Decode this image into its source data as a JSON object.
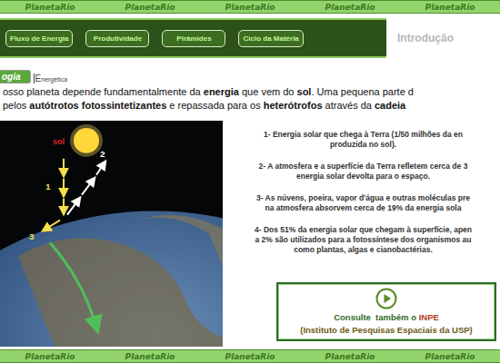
{
  "border": {
    "top": [
      "PlanetaRio",
      "PlanetaRio",
      "PlanetaRio",
      "PlanetaRio",
      "PlanetaRio"
    ],
    "bottom": [
      "PlanetaRio",
      "PlanetaRio",
      "PlanetaRio",
      "PlanetaRio",
      "PlanetaRio"
    ]
  },
  "nav": {
    "items": [
      {
        "label": "Fluxo de Energia",
        "selected": false
      },
      {
        "label": "Produtividade",
        "selected": false
      },
      {
        "label": "Pirâmides",
        "selected": false
      },
      {
        "label": "Ciclo da Matéria",
        "selected": false
      }
    ],
    "current": "Introdução"
  },
  "section_tab": {
    "label": "ogia",
    "subtitle": "Energética"
  },
  "intro_paragraph": [
    [
      {
        "text": "osso planeta depende fundamentalmente da ",
        "bold": false
      },
      {
        "text": "energia",
        "bold": true
      },
      {
        "text": " que vem do ",
        "bold": false
      },
      {
        "text": "sol",
        "bold": true
      },
      {
        "text": ". Uma pequena parte d",
        "bold": false
      }
    ],
    [
      {
        "text": "pelos ",
        "bold": false
      },
      {
        "text": "autótrotos fotossintetizantes",
        "bold": true
      },
      {
        "text": " e repassada para os ",
        "bold": false
      },
      {
        "text": "heterótrofos",
        "bold": true
      },
      {
        "text": " através da ",
        "bold": false
      },
      {
        "text": "cadeia",
        "bold": true
      }
    ]
  ],
  "figure": {
    "sun_label": "sol",
    "arrow_labels": [
      "1",
      "2",
      "3"
    ]
  },
  "facts": [
    {
      "lines": [
        "1- Energia solar que chega à Terra (1/50 milhões da en",
        "produzida no sol)."
      ]
    },
    {
      "lines": [
        "2- A atmosfera e a superfície da Terra refletem cerca de 3",
        "energia solar devolta para o espaço."
      ]
    },
    {
      "lines": [
        "3- As núvens, poeira, vapor d'água e outras moléculas pre",
        "na atmosfera absorvem cerca de 19% da energia sola"
      ]
    },
    {
      "lines": [
        "4- Dos 51% da energia solar que chegam à superfície, apen",
        "a 2% são utilizados para a fotossíntese dos organismos au",
        "como plantas, algas e cianobactérias."
      ]
    }
  ],
  "link_box": {
    "title": "Consulte  também o ",
    "highlight": "INPE",
    "subtitle": "(Instituto de Pesquisas Espaciais da USP)"
  }
}
